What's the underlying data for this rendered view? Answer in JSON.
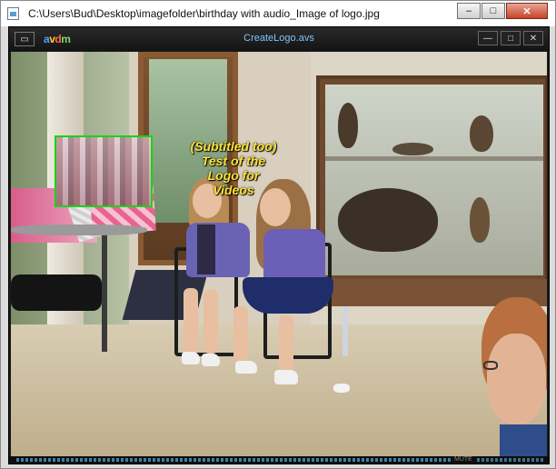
{
  "window": {
    "title": "C:\\Users\\Bud\\Desktop\\imagefolder\\birthday with audio_Image of logo.jpg",
    "controls": {
      "minimize": "–",
      "maximize": "□",
      "close": "✕"
    }
  },
  "player": {
    "title": "CreateLogo.avs",
    "brand": {
      "p1": "a",
      "p2": "v",
      "p3": "d",
      "p4": "m"
    },
    "menu_glyph": "▭",
    "controls": {
      "minimize": "—",
      "maximize": "□",
      "close": "✕"
    },
    "status": {
      "mute_label": "MUTE"
    }
  },
  "video": {
    "subtitle_lines": [
      "(Subtitled too)",
      "Test of the",
      "Logo for",
      "Videos"
    ]
  },
  "colors": {
    "logo_box_border": "#19d319",
    "subtitle_color": "#ffe338",
    "player_title_color": "#7fc4ff",
    "close_button": "#c7432a"
  }
}
